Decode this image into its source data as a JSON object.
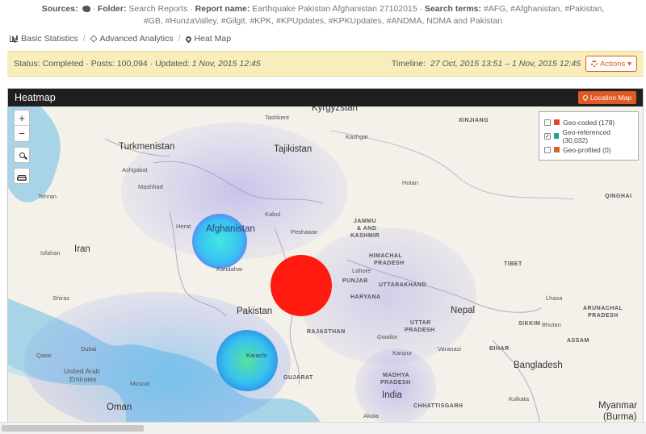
{
  "sources": {
    "sources_label": "Sources:",
    "folder_label": "Folder:",
    "folder_value": "Search Reports",
    "report_label": "Report name:",
    "report_value": "Earthquake Pakistan Afghanistan 27102015",
    "terms_label": "Search terms:",
    "terms_value": "#AFG, #Afghanistan, #Pakistan, #GB, #HunzaValley, #Gilgit, #KPK, #KPUpdates, #KPKUpdates, #ANDMA, NDMA and Pakistan",
    "sep": "·"
  },
  "breadcrumb": {
    "items": [
      {
        "label": "Basic Statistics",
        "icon": "bar-chart-icon"
      },
      {
        "label": "Advanced Analytics",
        "icon": "cube-icon"
      },
      {
        "label": "Heat Map",
        "icon": "map-pin-icon"
      }
    ],
    "sep": "/"
  },
  "status": {
    "status_text": "Status: Completed · Posts: 100,094 · Updated:",
    "updated": "1 Nov, 2015 12:45",
    "timeline_label": "Timeline:",
    "timeline_value": "27 Oct, 2015 13:51 – 1 Nov, 2015 12:45",
    "actions_label": "Actions"
  },
  "panel": {
    "title": "Heatmap",
    "location_button": "Location Map"
  },
  "map_controls": {
    "zoom_in": "+",
    "zoom_out": "−"
  },
  "legend": {
    "items": [
      {
        "label": "Geo-coded (178)",
        "checked": false,
        "color": "#e8442a"
      },
      {
        "label": "Geo-referenced (30,032)",
        "checked": true,
        "color": "#1aa58c"
      },
      {
        "label": "Geo-profiled (0)",
        "checked": false,
        "color": "#d2672e"
      }
    ],
    "check_mark": "✓"
  },
  "map_labels": {
    "kyrgyzstan": "Kyrgyzstan",
    "turkmenistan": "Turkmenistan",
    "tajikistan": "Tajikistan",
    "afghanistan": "Afghanistan",
    "iran": "Iran",
    "pakistan": "Pakistan",
    "nepal": "Nepal",
    "india": "India",
    "oman": "Oman",
    "bangladesh": "Bangladesh",
    "bhutan": "Bhutan",
    "myanmar": "Myanmar",
    "burma": "(Burma)",
    "uae_1": "United Arab",
    "uae_2": "Emirates",
    "qatar": "Qatar",
    "xinjiang": "XINJIANG",
    "tibet": "TIBET",
    "qinghai": "QINGHAI",
    "jk_1": "JAMMU",
    "jk_2": "& AND",
    "jk_3": "KASHMIR",
    "hp_1": "HIMACHAL",
    "hp_2": "PRADESH",
    "punjab": "PUNJAB",
    "uttarakhand": "UTTARAKHAND",
    "haryana": "HARYANA",
    "rajasthan": "RAJASTHAN",
    "up_1": "UTTAR",
    "up_2": "PRADESH",
    "bihar": "BIHAR",
    "assam": "ASSAM",
    "gujarat": "GUJARAT",
    "mp_1": "MADHYA",
    "mp_2": "PRADESH",
    "chhattisgarh": "CHHATTISGARH",
    "arunachal_1": "ARUNACHAL",
    "arunachal_2": "PRADESH",
    "sikkim": "SIKKIM",
    "tashkent": "Tashkent",
    "kashgar": "Kashgar",
    "hotan": "Hotan",
    "ashgabat": "Ashgabat",
    "mashhad": "Mashhad",
    "tehran": "Tehran",
    "herat": "Herat",
    "kabul": "Kabul",
    "peshawar": "Peshawar",
    "isfahan": "Isfahan",
    "kandahar": "Kandahar",
    "lahore": "Lahore",
    "shiraz": "Shiraz",
    "lhasa": "Lhasa",
    "karachi": "Karachi",
    "dubai": "Dubai",
    "muscat": "Muscat",
    "gwalior": "Gwalior",
    "varanasi": "Varanasi",
    "kolkata": "Kolkata",
    "akola": "Akola",
    "kanpur": "Kanpur"
  }
}
